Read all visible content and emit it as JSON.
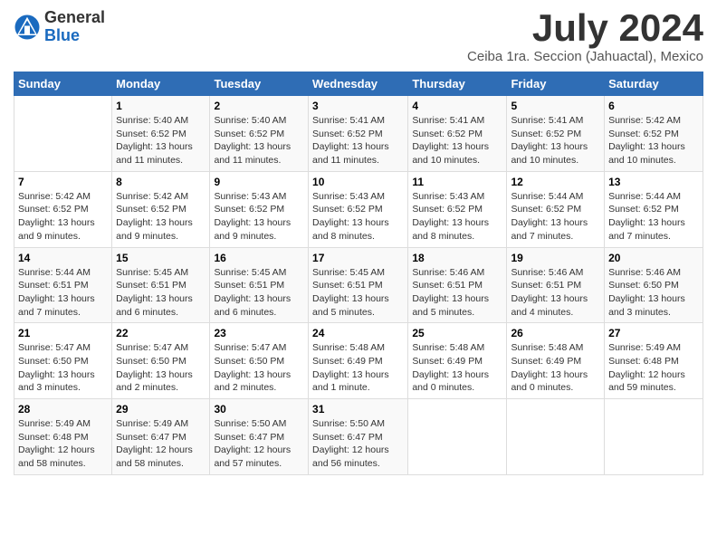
{
  "header": {
    "logo_general": "General",
    "logo_blue": "Blue",
    "month_title": "July 2024",
    "location": "Ceiba 1ra. Seccion (Jahuactal), Mexico"
  },
  "columns": [
    "Sunday",
    "Monday",
    "Tuesday",
    "Wednesday",
    "Thursday",
    "Friday",
    "Saturday"
  ],
  "weeks": [
    [
      {
        "day": "",
        "info": ""
      },
      {
        "day": "1",
        "info": "Sunrise: 5:40 AM\nSunset: 6:52 PM\nDaylight: 13 hours\nand 11 minutes."
      },
      {
        "day": "2",
        "info": "Sunrise: 5:40 AM\nSunset: 6:52 PM\nDaylight: 13 hours\nand 11 minutes."
      },
      {
        "day": "3",
        "info": "Sunrise: 5:41 AM\nSunset: 6:52 PM\nDaylight: 13 hours\nand 11 minutes."
      },
      {
        "day": "4",
        "info": "Sunrise: 5:41 AM\nSunset: 6:52 PM\nDaylight: 13 hours\nand 10 minutes."
      },
      {
        "day": "5",
        "info": "Sunrise: 5:41 AM\nSunset: 6:52 PM\nDaylight: 13 hours\nand 10 minutes."
      },
      {
        "day": "6",
        "info": "Sunrise: 5:42 AM\nSunset: 6:52 PM\nDaylight: 13 hours\nand 10 minutes."
      }
    ],
    [
      {
        "day": "7",
        "info": "Sunrise: 5:42 AM\nSunset: 6:52 PM\nDaylight: 13 hours\nand 9 minutes."
      },
      {
        "day": "8",
        "info": "Sunrise: 5:42 AM\nSunset: 6:52 PM\nDaylight: 13 hours\nand 9 minutes."
      },
      {
        "day": "9",
        "info": "Sunrise: 5:43 AM\nSunset: 6:52 PM\nDaylight: 13 hours\nand 9 minutes."
      },
      {
        "day": "10",
        "info": "Sunrise: 5:43 AM\nSunset: 6:52 PM\nDaylight: 13 hours\nand 8 minutes."
      },
      {
        "day": "11",
        "info": "Sunrise: 5:43 AM\nSunset: 6:52 PM\nDaylight: 13 hours\nand 8 minutes."
      },
      {
        "day": "12",
        "info": "Sunrise: 5:44 AM\nSunset: 6:52 PM\nDaylight: 13 hours\nand 7 minutes."
      },
      {
        "day": "13",
        "info": "Sunrise: 5:44 AM\nSunset: 6:52 PM\nDaylight: 13 hours\nand 7 minutes."
      }
    ],
    [
      {
        "day": "14",
        "info": "Sunrise: 5:44 AM\nSunset: 6:51 PM\nDaylight: 13 hours\nand 7 minutes."
      },
      {
        "day": "15",
        "info": "Sunrise: 5:45 AM\nSunset: 6:51 PM\nDaylight: 13 hours\nand 6 minutes."
      },
      {
        "day": "16",
        "info": "Sunrise: 5:45 AM\nSunset: 6:51 PM\nDaylight: 13 hours\nand 6 minutes."
      },
      {
        "day": "17",
        "info": "Sunrise: 5:45 AM\nSunset: 6:51 PM\nDaylight: 13 hours\nand 5 minutes."
      },
      {
        "day": "18",
        "info": "Sunrise: 5:46 AM\nSunset: 6:51 PM\nDaylight: 13 hours\nand 5 minutes."
      },
      {
        "day": "19",
        "info": "Sunrise: 5:46 AM\nSunset: 6:51 PM\nDaylight: 13 hours\nand 4 minutes."
      },
      {
        "day": "20",
        "info": "Sunrise: 5:46 AM\nSunset: 6:50 PM\nDaylight: 13 hours\nand 3 minutes."
      }
    ],
    [
      {
        "day": "21",
        "info": "Sunrise: 5:47 AM\nSunset: 6:50 PM\nDaylight: 13 hours\nand 3 minutes."
      },
      {
        "day": "22",
        "info": "Sunrise: 5:47 AM\nSunset: 6:50 PM\nDaylight: 13 hours\nand 2 minutes."
      },
      {
        "day": "23",
        "info": "Sunrise: 5:47 AM\nSunset: 6:50 PM\nDaylight: 13 hours\nand 2 minutes."
      },
      {
        "day": "24",
        "info": "Sunrise: 5:48 AM\nSunset: 6:49 PM\nDaylight: 13 hours\nand 1 minute."
      },
      {
        "day": "25",
        "info": "Sunrise: 5:48 AM\nSunset: 6:49 PM\nDaylight: 13 hours\nand 0 minutes."
      },
      {
        "day": "26",
        "info": "Sunrise: 5:48 AM\nSunset: 6:49 PM\nDaylight: 13 hours\nand 0 minutes."
      },
      {
        "day": "27",
        "info": "Sunrise: 5:49 AM\nSunset: 6:48 PM\nDaylight: 12 hours\nand 59 minutes."
      }
    ],
    [
      {
        "day": "28",
        "info": "Sunrise: 5:49 AM\nSunset: 6:48 PM\nDaylight: 12 hours\nand 58 minutes."
      },
      {
        "day": "29",
        "info": "Sunrise: 5:49 AM\nSunset: 6:47 PM\nDaylight: 12 hours\nand 58 minutes."
      },
      {
        "day": "30",
        "info": "Sunrise: 5:50 AM\nSunset: 6:47 PM\nDaylight: 12 hours\nand 57 minutes."
      },
      {
        "day": "31",
        "info": "Sunrise: 5:50 AM\nSunset: 6:47 PM\nDaylight: 12 hours\nand 56 minutes."
      },
      {
        "day": "",
        "info": ""
      },
      {
        "day": "",
        "info": ""
      },
      {
        "day": "",
        "info": ""
      }
    ]
  ]
}
